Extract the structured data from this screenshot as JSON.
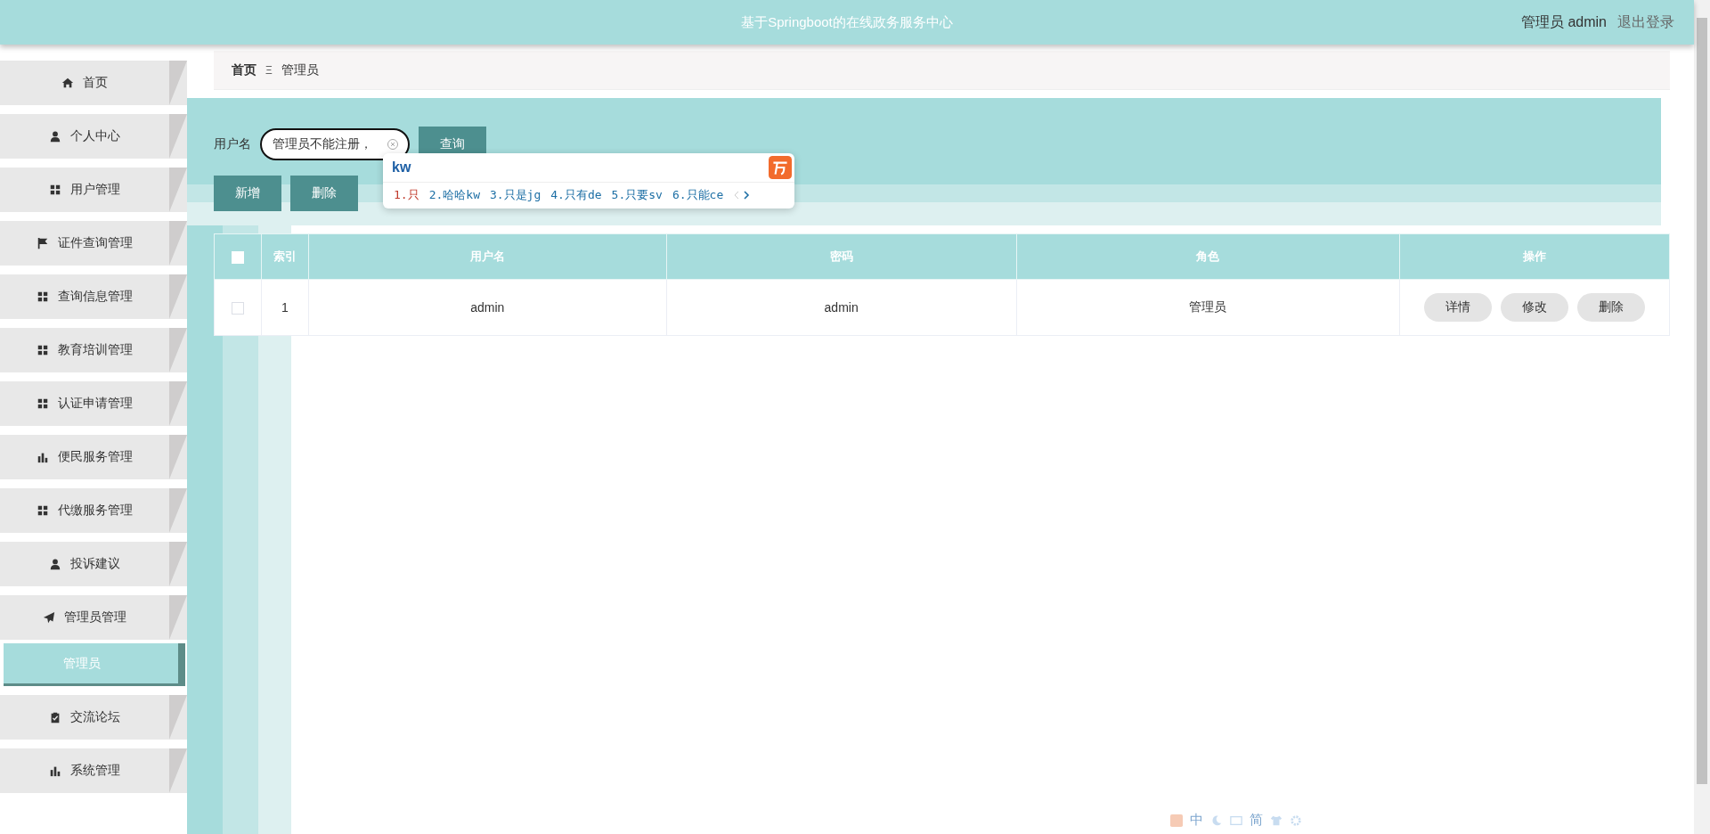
{
  "header": {
    "title": "基于Springboot的在线政务服务中心",
    "user_role": "管理员",
    "username": "admin",
    "logout": "退出登录"
  },
  "sidebar": {
    "items": [
      {
        "label": "首页",
        "kind": "home",
        "selected": false
      },
      {
        "label": "个人中心",
        "kind": "user",
        "selected": false
      },
      {
        "label": "用户管理",
        "kind": "grid",
        "selected": false
      },
      {
        "label": "证件查询管理",
        "kind": "flag",
        "selected": false
      },
      {
        "label": "查询信息管理",
        "kind": "grid",
        "selected": false
      },
      {
        "label": "教育培训管理",
        "kind": "grid",
        "selected": false
      },
      {
        "label": "认证申请管理",
        "kind": "grid",
        "selected": false
      },
      {
        "label": "便民服务管理",
        "kind": "chart",
        "selected": false
      },
      {
        "label": "代缴服务管理",
        "kind": "grid",
        "selected": false
      },
      {
        "label": "投诉建议",
        "kind": "user",
        "selected": false
      },
      {
        "label": "管理员管理",
        "kind": "send",
        "selected": false,
        "children": [
          {
            "label": "管理员",
            "selected": true
          }
        ]
      },
      {
        "label": "交流论坛",
        "kind": "clipboard",
        "selected": false
      },
      {
        "label": "系统管理",
        "kind": "chart",
        "selected": false
      }
    ]
  },
  "breadcrumb": {
    "items": [
      "首页",
      "管理员"
    ],
    "separator": "Ξ"
  },
  "search": {
    "label": "用户名",
    "value": "管理员不能注册，",
    "button": "查询"
  },
  "actions": [
    "新增",
    "删除"
  ],
  "ime": {
    "composition": "kw",
    "candidates": [
      {
        "text": "1.只",
        "selected": true
      },
      {
        "text": "2.哈哈kw",
        "selected": false
      },
      {
        "text": "3.只是jg",
        "selected": false
      },
      {
        "text": "4.只有de",
        "selected": false
      },
      {
        "text": "5.只要sv",
        "selected": false
      },
      {
        "text": "6.只能ce",
        "selected": false
      }
    ]
  },
  "table": {
    "select_all": false,
    "columns": [
      "索引",
      "用户名",
      "密码",
      "角色",
      "操作"
    ],
    "rows": [
      {
        "checked": false,
        "cells": [
          "1",
          "admin",
          "admin",
          "管理员"
        ],
        "actions": [
          "详情",
          "修改",
          "删除"
        ]
      }
    ]
  },
  "ime_toolbar": {
    "items": [
      "中",
      "简"
    ]
  }
}
